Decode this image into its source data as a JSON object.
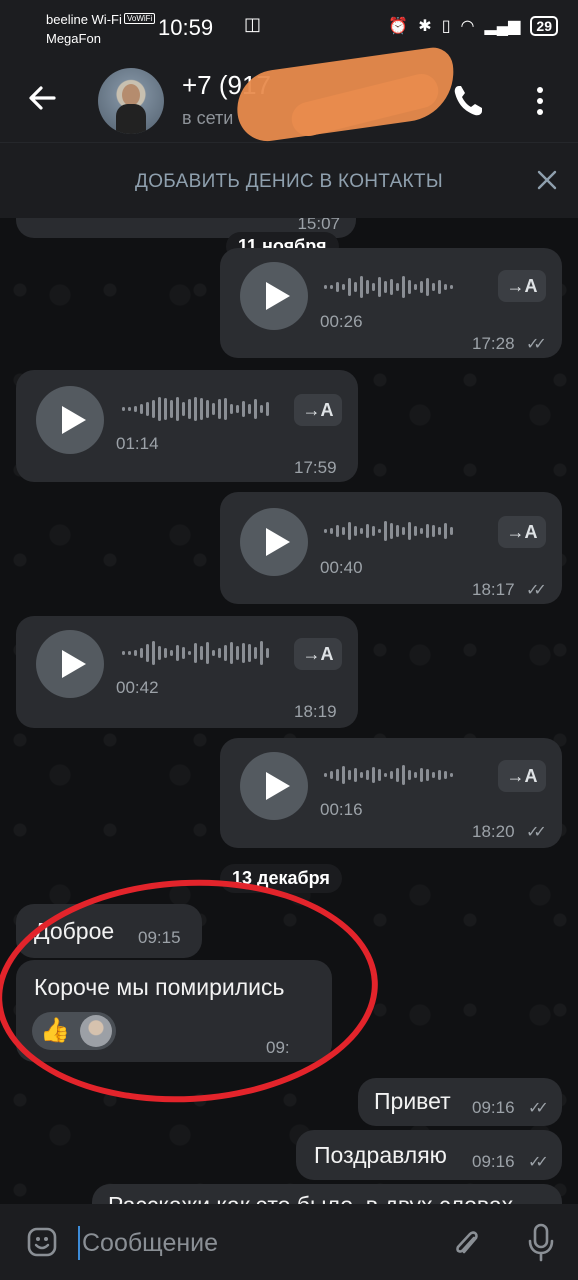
{
  "status_bar": {
    "carrier1": "beeline Wi-Fi",
    "volte": "VoWiFi",
    "carrier2": "MegaFon",
    "time": "10:59",
    "battery": "29"
  },
  "header": {
    "contact_name": "+7 (917",
    "contact_status": "в сети"
  },
  "banner": {
    "label": "ДОБАВИТЬ ДЕНИС В КОНТАКТЫ"
  },
  "chat": {
    "top_partial_time": "15:07",
    "date_1": "11 ноября",
    "date_2": "13 декабря",
    "transcribe_label": "→A",
    "voice_messages": [
      {
        "duration": "00:26",
        "time": "17:28",
        "direction": "out"
      },
      {
        "duration": "01:14",
        "time": "17:59",
        "direction": "in"
      },
      {
        "duration": "00:40",
        "time": "18:17",
        "direction": "out"
      },
      {
        "duration": "00:42",
        "time": "18:19",
        "direction": "in"
      },
      {
        "duration": "00:16",
        "time": "18:20",
        "direction": "out"
      }
    ],
    "text_messages": [
      {
        "text": "Доброе",
        "time": "09:15",
        "direction": "in"
      },
      {
        "text": "Короче мы помирились",
        "time": "09:",
        "direction": "in",
        "reaction": "👍"
      },
      {
        "text": "Привет",
        "time": "09:16",
        "direction": "out"
      },
      {
        "text": "Поздравляю",
        "time": "09:16",
        "direction": "out"
      },
      {
        "text": "Расскажи как это было, в двух словах",
        "time": "",
        "direction": "out"
      }
    ]
  },
  "input": {
    "placeholder": "Сообщение"
  },
  "icons": {
    "back": "arrow-left-icon",
    "call": "phone-icon",
    "menu": "more-vert-icon",
    "close": "close-icon",
    "emoji": "emoji-icon",
    "attach": "paperclip-icon",
    "mic": "microphone-icon"
  },
  "colors": {
    "background": "#111214",
    "bar": "#1c1d20",
    "bubble": "#2a2c30",
    "annotation_red": "#e3242b",
    "scribble_orange": "#e88b4d"
  }
}
